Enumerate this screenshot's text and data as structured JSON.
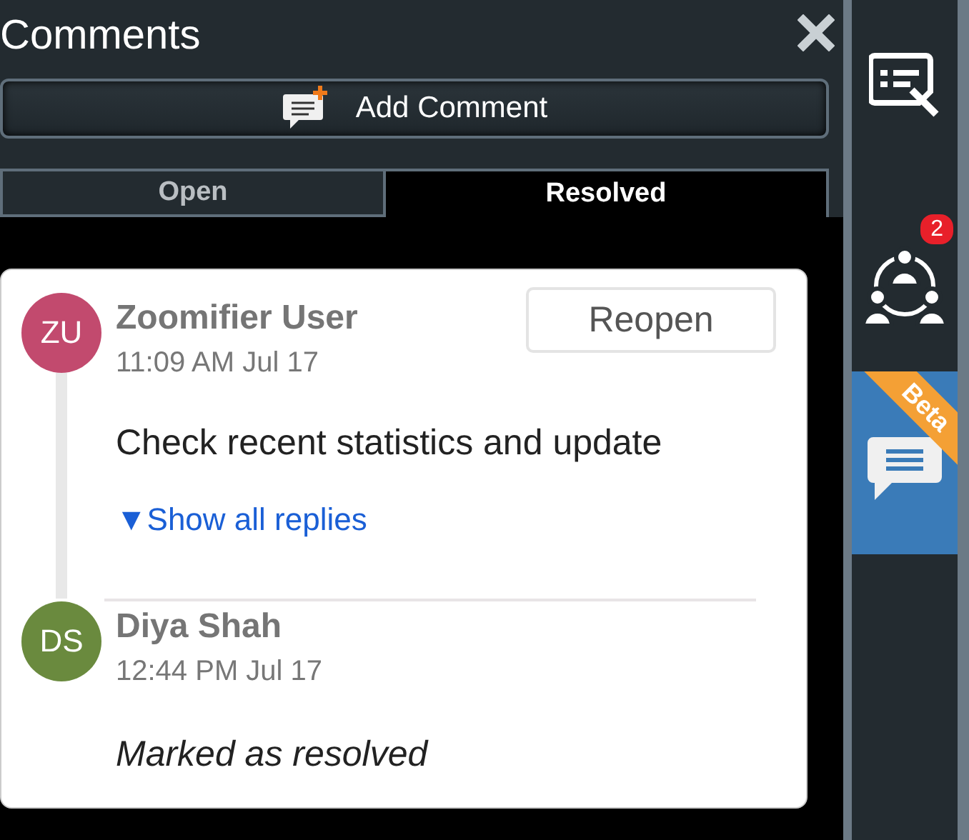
{
  "panel": {
    "title": "Comments",
    "add_button": "Add Comment"
  },
  "tabs": [
    {
      "label": "Open",
      "selected": false
    },
    {
      "label": "Resolved",
      "selected": true
    }
  ],
  "thread": {
    "action_button": "Reopen",
    "entries": [
      {
        "kind": "comment",
        "initials": "ZU",
        "color": "#c24a6e",
        "author": "Zoomifier User",
        "time": "11:09 AM Jul 17",
        "text": "Check recent statistics and update",
        "link": "▼Show all replies"
      },
      {
        "kind": "status",
        "initials": "DS",
        "color": "#6a8a3e",
        "author": "Diya Shah",
        "time": "12:44 PM Jul 17",
        "text": "Marked as resolved"
      }
    ]
  },
  "rail": {
    "items": [
      {
        "kind": "form",
        "selected": false
      },
      {
        "kind": "people",
        "badge": "2",
        "selected": false
      },
      {
        "kind": "chat",
        "ribbon": "Beta",
        "selected": true
      }
    ]
  }
}
